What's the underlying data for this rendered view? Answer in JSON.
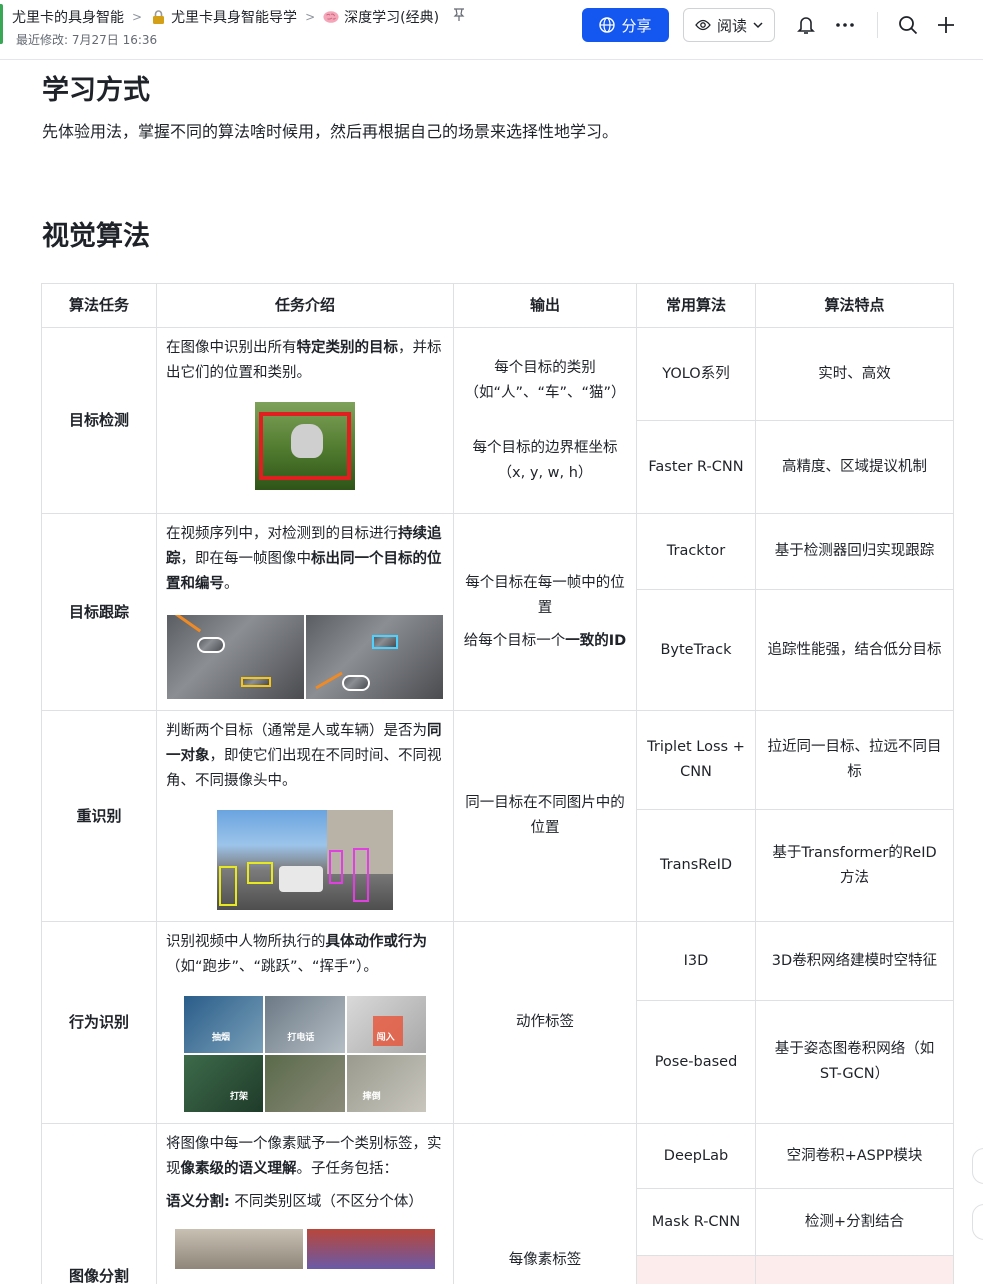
{
  "header": {
    "breadcrumbs": [
      {
        "label": "尤里卡的具身智能",
        "icon": "folder-icon"
      },
      {
        "label": "尤里卡具身智能导学",
        "icon": "lock-icon"
      },
      {
        "label": "深度学习(经典)",
        "icon": "brain-emoji-icon"
      }
    ],
    "last_modified": "最近修改: 7月27日 16:36",
    "share_label": "分享",
    "read_label": "阅读"
  },
  "section1": {
    "title": "学习方式",
    "text": "先体验用法，掌握不同的算法啥时候用，然后再根据自己的场景来选择性地学习。"
  },
  "section2": {
    "title": "视觉算法"
  },
  "table": {
    "headers": [
      "算法任务",
      "任务介绍",
      "输出",
      "常用算法",
      "算法特点"
    ],
    "detection": {
      "task": "目标检测",
      "intro_a": "在图像中识别出所有",
      "intro_b": "特定类别的目标",
      "intro_c": "，并标出它们的位置和类别。",
      "out1": "每个目标的类别（如“人”、“车”、“猫”）",
      "out2": "每个目标的边界框坐标（x, y, w, h）",
      "alg1": "YOLO系列",
      "feat1": "实时、高效",
      "alg2": "Faster R-CNN",
      "feat2": "高精度、区域提议机制"
    },
    "tracking": {
      "task": "目标跟踪",
      "intro_a": "在视频序列中，对检测到的目标进行",
      "intro_b": "持续追踪",
      "intro_c": "，即在每一帧图像中",
      "intro_d": "标出同一个目标的位置和编号",
      "intro_e": "。",
      "out1": "每个目标在每一帧中的位置",
      "out2a": "给每个目标一个",
      "out2b": "一致的ID",
      "alg1": "Tracktor",
      "feat1": "基于检测器回归实现跟踪",
      "alg2": "ByteTrack",
      "feat2": "追踪性能强，结合低分目标"
    },
    "reid": {
      "task": "重识别",
      "intro_a": "判断两个目标（通常是人或车辆）是否为",
      "intro_b": "同一对象",
      "intro_c": "，即使它们出现在不同时间、不同视角、不同摄像头中。",
      "out": "同一目标在不同图片中的位置",
      "alg1": "Triplet Loss + CNN",
      "feat1": "拉近同一目标、拉远不同目标",
      "alg2": "TransReID",
      "feat2": "基于Transformer的ReID方法"
    },
    "action": {
      "task": "行为识别",
      "intro_a": "识别视频中人物所执行的",
      "intro_b": "具体动作或行为",
      "intro_c": "（如“跑步”、“跳跃”、“挥手”）。",
      "image_tags": [
        "抽烟",
        "打电话",
        "闯入",
        "打架",
        "摔倒"
      ],
      "out": "动作标签",
      "alg1": "I3D",
      "feat1": "3D卷积网络建模时空特征",
      "alg2": "Pose-based",
      "feat2": "基于姿态图卷积网络（如ST-GCN）"
    },
    "segmentation": {
      "task": "图像分割",
      "intro_a": "将图像中每一个像素赋予一个类别标签，实现",
      "intro_b": "像素级的语义理解",
      "intro_c": "。子任务包括：",
      "sub_label": "语义分割:",
      "sub_text": " 不同类别区域（不区分个体）",
      "out": "每像素标签",
      "alg1": "DeepLab",
      "feat1": "空洞卷积+ASPP模块",
      "alg2": "Mask R-CNN",
      "feat2": "检测+分割结合"
    }
  }
}
